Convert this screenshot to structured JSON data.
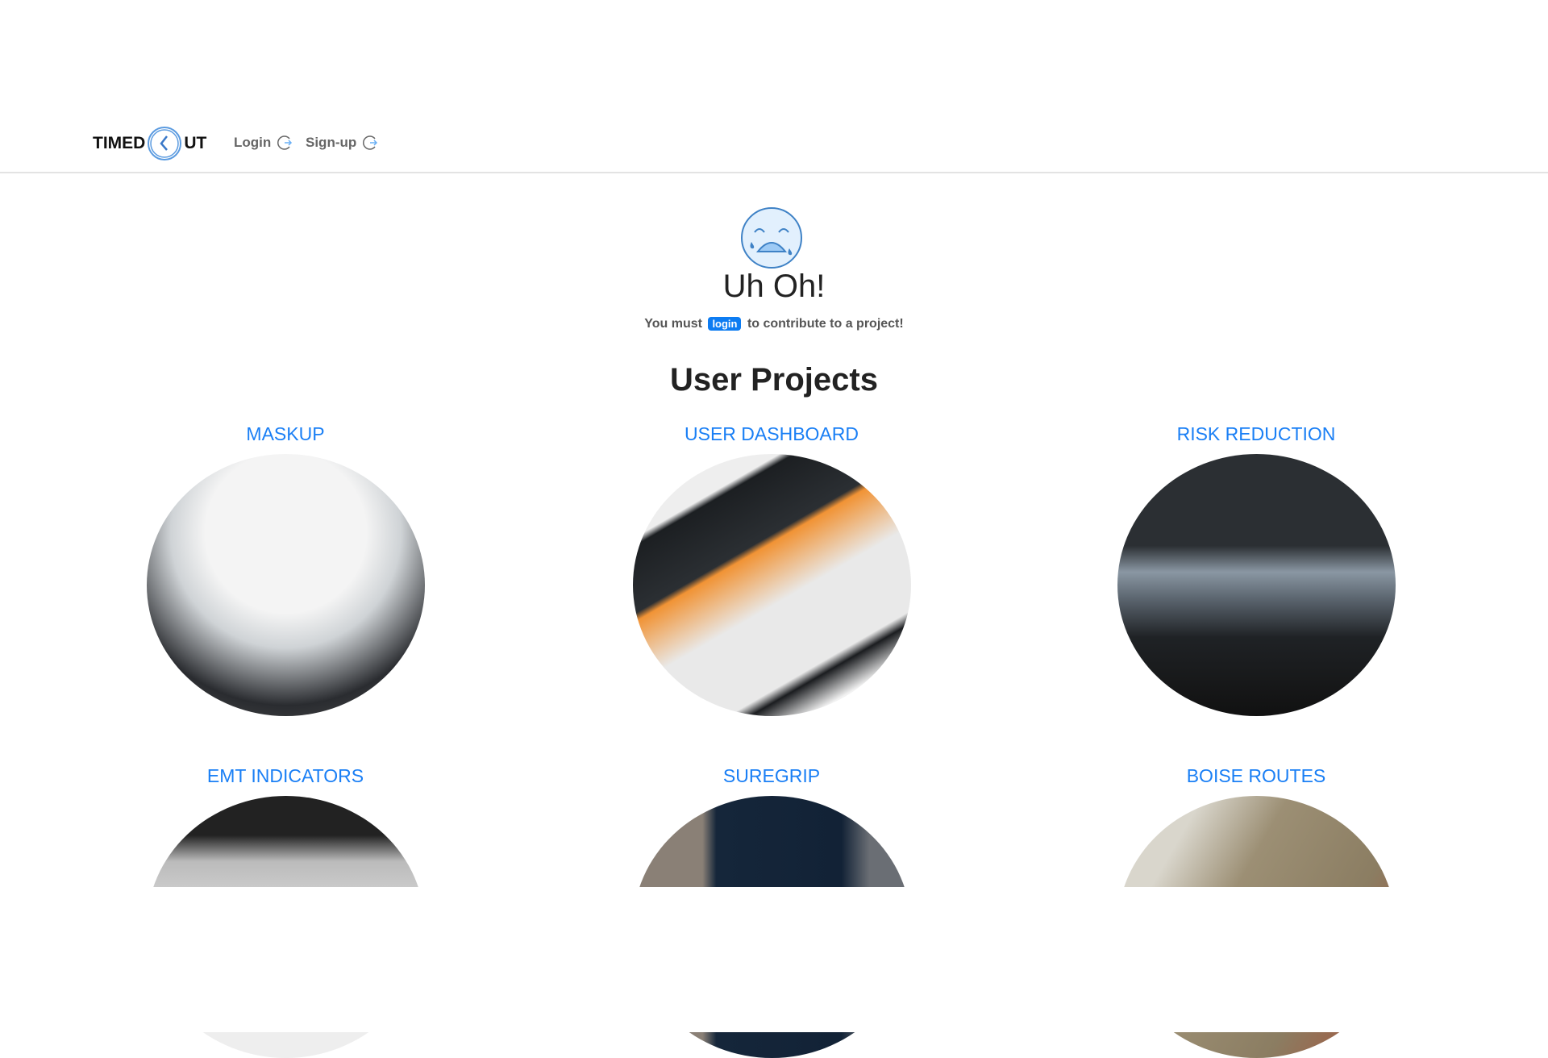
{
  "nav": {
    "logo_left": "TIMED",
    "logo_right": "UT",
    "login": "Login",
    "signup": "Sign-up",
    "link_icon": "refresh-arrow-icon"
  },
  "error": {
    "icon": "crying-face-icon",
    "title": "Uh Oh!",
    "msg_before": "You must",
    "msg_badge": "login",
    "msg_after": "to contribute to a project!"
  },
  "projects": {
    "heading": "User Projects",
    "items": [
      {
        "title": "MASKUP"
      },
      {
        "title": "USER DASHBOARD"
      },
      {
        "title": "RISK REDUCTION"
      },
      {
        "title": "EMT INDICATORS"
      },
      {
        "title": "SUREGRIP"
      },
      {
        "title": "BOISE ROUTES"
      }
    ]
  },
  "colors": {
    "accent": "#1a7ff5",
    "badge": "#0d7cf2"
  }
}
